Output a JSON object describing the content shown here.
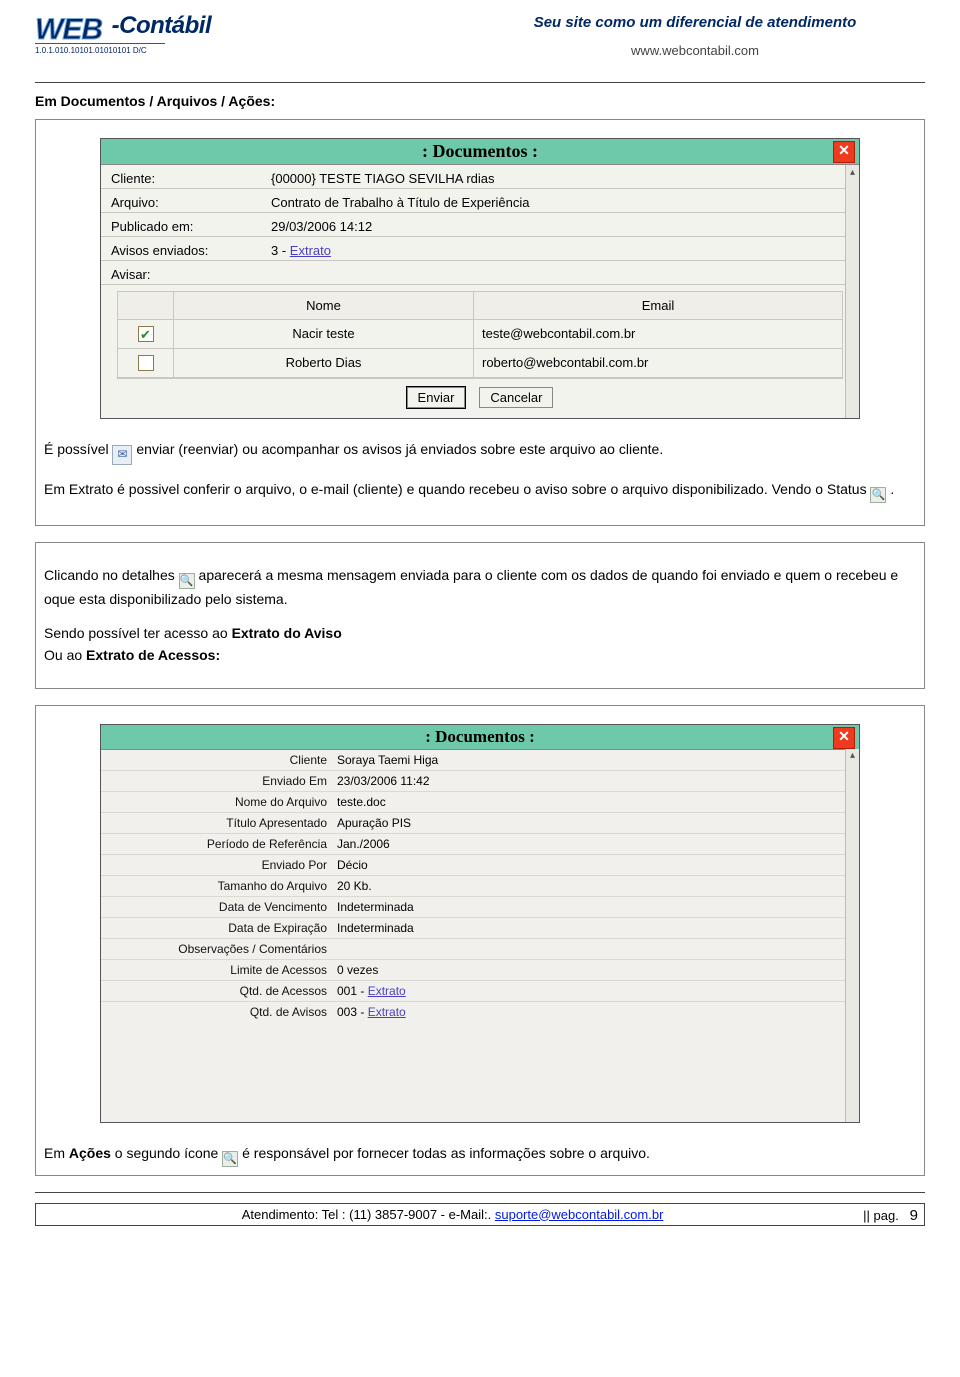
{
  "header": {
    "logo_web": "WEB",
    "logo_contabil": "-Contábil",
    "logo_sub": "1.0.1.010.10101.01010101 D/C",
    "tagline": "Seu site como um diferencial de atendimento",
    "site_url": "www.webcontabil.com"
  },
  "section_title": "Em Documentos / Arquivos / Ações:",
  "dialog1": {
    "title": ": Documentos :",
    "fields": {
      "cliente_label": "Cliente:",
      "cliente_value": "{00000} TESTE TIAGO SEVILHA rdias",
      "arquivo_label": "Arquivo:",
      "arquivo_value": "Contrato de Trabalho à Título de Experiência",
      "publicado_label": "Publicado em:",
      "publicado_value": "29/03/2006 14:12",
      "avisos_label": "Avisos enviados:",
      "avisos_value_prefix": "3 - ",
      "avisos_link": "Extrato",
      "avisar_label": "Avisar:"
    },
    "table": {
      "col_nome": "Nome",
      "col_email": "Email",
      "rows": [
        {
          "checked": true,
          "nome": "Nacir teste",
          "email": "teste@webcontabil.com.br"
        },
        {
          "checked": false,
          "nome": "Roberto Dias",
          "email": "roberto@webcontabil.com.br"
        }
      ]
    },
    "buttons": {
      "enviar": "Enviar",
      "cancelar": "Cancelar"
    }
  },
  "paragraph1": {
    "p1_a": "É possível ",
    "p1_b": " enviar (reenviar) ou acompanhar os avisos já enviados sobre este arquivo ao cliente.",
    "p2_a": "Em Extrato é possivel conferir o arquivo, o e-mail (cliente) e quando recebeu o aviso sobre o arquivo disponibilizado. Vendo o Status ",
    "p2_b": "."
  },
  "paragraph2": {
    "a": "Clicando no detalhes ",
    "b": " aparecerá a mesma mensagem enviada para o cliente com os dados de quando foi enviado e quem o recebeu e oque esta disponibilizado pelo sistema.",
    "c1": "Sendo possível ter acesso ao ",
    "c1b": "Extrato do Aviso",
    "c2": "Ou ao ",
    "c2b": "Extrato de Acessos:"
  },
  "dialog2": {
    "title": ": Documentos :",
    "rows": [
      {
        "k": "Cliente",
        "v": "Soraya Taemi Higa"
      },
      {
        "k": "Enviado Em",
        "v": "23/03/2006 11:42"
      },
      {
        "k": "Nome do Arquivo",
        "v": "teste.doc"
      },
      {
        "k": "Título Apresentado",
        "v": "Apuração PIS"
      },
      {
        "k": "Período de Referência",
        "v": "Jan./2006"
      },
      {
        "k": "Enviado Por",
        "v": "Décio"
      },
      {
        "k": "Tamanho do Arquivo",
        "v": "20 Kb."
      },
      {
        "k": "Data de Vencimento",
        "v": "Indeterminada"
      },
      {
        "k": "Data de Expiração",
        "v": "Indeterminada"
      },
      {
        "k": "Observações / Comentários",
        "v": ""
      },
      {
        "k": "Limite de Acessos",
        "v": "0 vezes"
      },
      {
        "k": "Qtd. de Acessos",
        "v_prefix": "001 - ",
        "v_link": "Extrato"
      },
      {
        "k": "Qtd. de Avisos",
        "v_prefix": "003 - ",
        "v_link": "Extrato"
      }
    ]
  },
  "paragraph3": {
    "a": "Em ",
    "ab": "Ações",
    "b": " o segundo ícone ",
    "c": " é responsável por fornecer todas as informações sobre o arquivo."
  },
  "footer": {
    "prefix": "Atendimento:  Tel : (11) 3857-9007 - e-Mail:. ",
    "mail": "suporte@webcontabil.com.br",
    "suffix": "|| pag.",
    "page": "9"
  }
}
